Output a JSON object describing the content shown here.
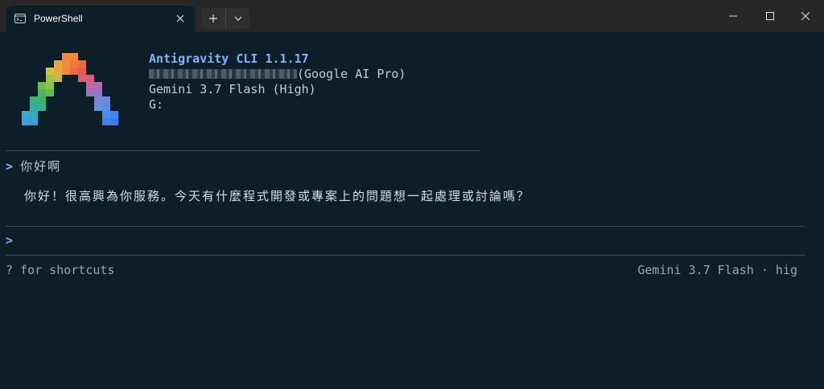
{
  "window": {
    "tab_title": "PowerShell"
  },
  "header": {
    "app_name": "Antigravity CLI 1.1.17",
    "account_plan": "(Google AI Pro)",
    "model": "Gemini 3.7 Flash (High)",
    "path": "G:"
  },
  "conversation": {
    "prompt_symbol": ">",
    "user_message": "你好啊",
    "assistant_reply": "你好！很高興為你服務。今天有什麼程式開發或專案上的問題想一起處理或討論嗎？"
  },
  "input": {
    "prompt_symbol": ">",
    "value": ""
  },
  "footer": {
    "shortcuts_hint": "? for shortcuts",
    "model_status": "Gemini 3.7 Flash · hig"
  },
  "colors": {
    "background": "#0c1f29",
    "accent": "#7fb3ff",
    "titlebar": "#272727"
  }
}
